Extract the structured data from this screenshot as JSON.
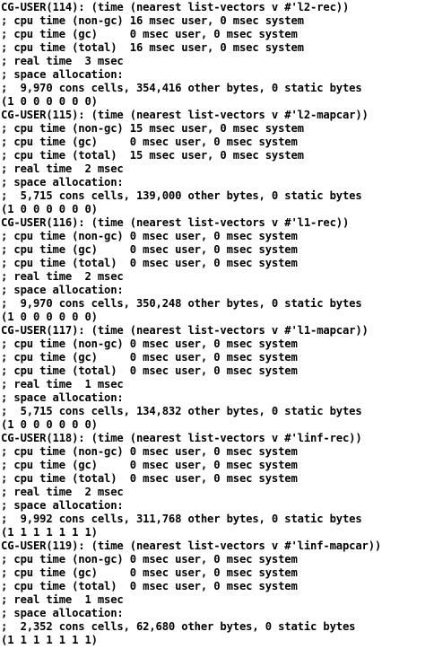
{
  "terminal": {
    "lines": [
      "CG-USER(114): (time (nearest list-vectors v #'l2-rec))",
      "; cpu time (non-gc) 16 msec user, 0 msec system",
      "; cpu time (gc)     0 msec user, 0 msec system",
      "; cpu time (total)  16 msec user, 0 msec system",
      "; real time  3 msec",
      "; space allocation:",
      ";  9,970 cons cells, 354,416 other bytes, 0 static bytes",
      "(1 0 0 0 0 0 0)",
      "CG-USER(115): (time (nearest list-vectors v #'l2-mapcar))",
      "; cpu time (non-gc) 15 msec user, 0 msec system",
      "; cpu time (gc)     0 msec user, 0 msec system",
      "; cpu time (total)  15 msec user, 0 msec system",
      "; real time  2 msec",
      "; space allocation:",
      ";  5,715 cons cells, 139,000 other bytes, 0 static bytes",
      "(1 0 0 0 0 0 0)",
      "CG-USER(116): (time (nearest list-vectors v #'l1-rec))",
      "; cpu time (non-gc) 0 msec user, 0 msec system",
      "; cpu time (gc)     0 msec user, 0 msec system",
      "; cpu time (total)  0 msec user, 0 msec system",
      "; real time  2 msec",
      "; space allocation:",
      ";  9,970 cons cells, 350,248 other bytes, 0 static bytes",
      "(1 0 0 0 0 0 0)",
      "CG-USER(117): (time (nearest list-vectors v #'l1-mapcar))",
      "; cpu time (non-gc) 0 msec user, 0 msec system",
      "; cpu time (gc)     0 msec user, 0 msec system",
      "; cpu time (total)  0 msec user, 0 msec system",
      "; real time  1 msec",
      "; space allocation:",
      ";  5,715 cons cells, 134,832 other bytes, 0 static bytes",
      "(1 0 0 0 0 0 0)",
      "CG-USER(118): (time (nearest list-vectors v #'linf-rec))",
      "; cpu time (non-gc) 0 msec user, 0 msec system",
      "; cpu time (gc)     0 msec user, 0 msec system",
      "; cpu time (total)  0 msec user, 0 msec system",
      "; real time  2 msec",
      "; space allocation:",
      ";  9,992 cons cells, 311,768 other bytes, 0 static bytes",
      "(1 1 1 1 1 1 1)",
      "CG-USER(119): (time (nearest list-vectors v #'linf-mapcar))",
      "; cpu time (non-gc) 0 msec user, 0 msec system",
      "; cpu time (gc)     0 msec user, 0 msec system",
      "; cpu time (total)  0 msec user, 0 msec system",
      "; real time  1 msec",
      "; space allocation:",
      ";  2,352 cons cells, 62,680 other bytes, 0 static bytes",
      "(1 1 1 1 1 1 1)"
    ]
  }
}
